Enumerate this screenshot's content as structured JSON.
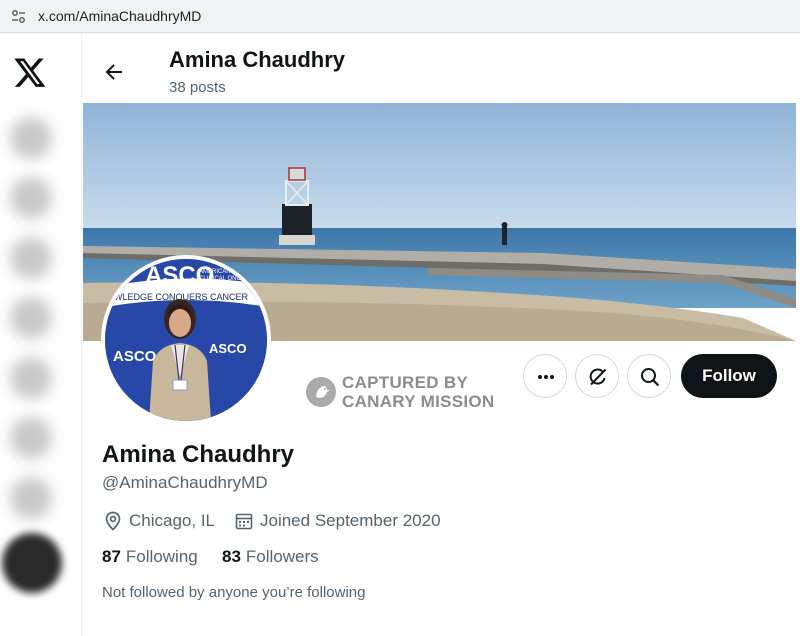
{
  "browser": {
    "url": "x.com/AminaChaudhryMD",
    "site_settings_icon": "tune-icon"
  },
  "nav": {
    "logo": "x-logo-icon"
  },
  "header": {
    "back_icon": "arrow-left-icon",
    "name": "Amina Chaudhry",
    "posts": "38 posts"
  },
  "watermark": {
    "line1": "CAPTURED BY",
    "line2": "CANARY MISSION"
  },
  "avatar": {
    "backdrop_text_1": "ASCO",
    "backdrop_text_2": "ASCO",
    "backdrop_text_3": "AMERICAN",
    "backdrop_text_4": "CLINICAL ONCOLOGY",
    "backdrop_text_5": "OWLEDGE CONQUERS CANCER"
  },
  "actions": {
    "more_icon": "more-dots-icon",
    "grok_icon": "grok-icon",
    "search_icon": "search-icon",
    "follow_label": "Follow"
  },
  "profile": {
    "name": "Amina Chaudhry",
    "handle": "@AminaChaudhryMD",
    "location": "Chicago, IL",
    "joined": "Joined September 2020",
    "following_count": "87",
    "following_label": "Following",
    "followers_count": "83",
    "followers_label": "Followers",
    "followed_by": "Not followed by anyone you’re following"
  },
  "colors": {
    "text_primary": "#0f1419",
    "text_secondary": "#536471",
    "follow_bg": "#0f1419",
    "border": "#cfd9de"
  }
}
